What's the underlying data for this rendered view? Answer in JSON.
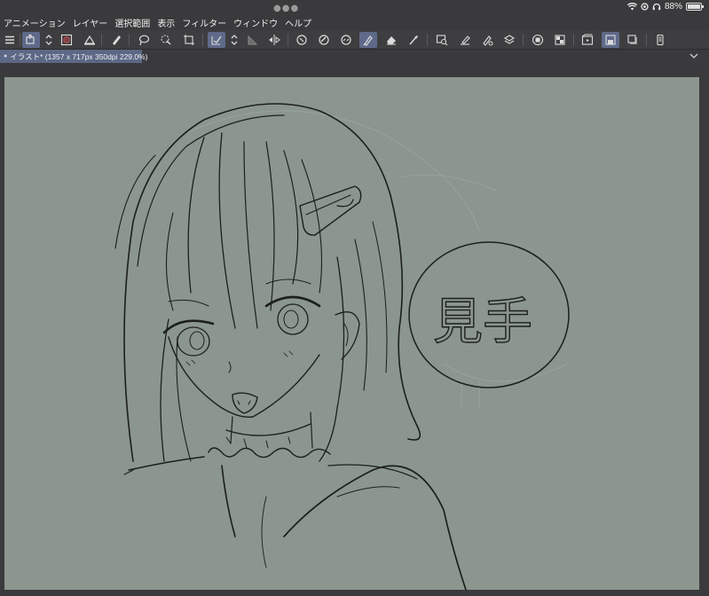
{
  "status": {
    "battery_percent": "88%"
  },
  "menu": {
    "items": [
      "アニメーション",
      "レイヤー",
      "選択範囲",
      "表示",
      "フィルター",
      "ウィンドウ",
      "ヘルプ"
    ]
  },
  "toolbar": {
    "icons": [
      "menu-icon",
      "layer-move-icon",
      "stepper-icon",
      "spiral-icon",
      "ruler-icon",
      "pen-icon",
      "lasso-icon",
      "select-cursor-icon",
      "transform-icon",
      "check-icon",
      "stepper-icon",
      "triangle-icon",
      "flip-icon",
      "refresh-icon",
      "paint-icon",
      "link-icon",
      "brush-icon",
      "eraser-icon",
      "eyedropper-icon",
      "search-layer-icon",
      "edit-icon",
      "settings-pen-icon",
      "layers-icon",
      "record-icon",
      "grid-icon",
      "film-icon",
      "save-icon",
      "copy-icon",
      "phone-icon"
    ],
    "accent_color": "#5f6a8a"
  },
  "document": {
    "tab_label": "イラスト* (1357 x 717px 350dpi 229.0%)"
  },
  "canvas": {
    "background_color": "#8b968f",
    "speech_bubble_text": "見手"
  }
}
